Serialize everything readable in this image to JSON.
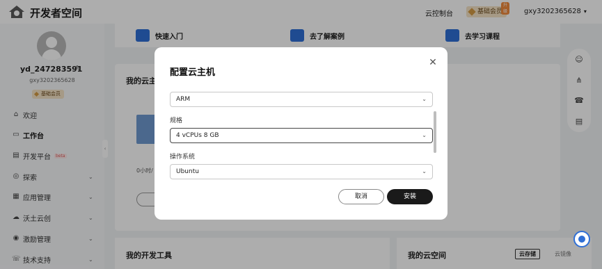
{
  "header": {
    "app_title": "开发者空间",
    "console_label": "云控制台",
    "member_label": "基础会员",
    "member_tag": "升级",
    "username": "gxy3202365628"
  },
  "sidebar": {
    "display_name": "yd_247283591",
    "user_id": "gxy3202365628",
    "member_label": "基础会员",
    "items": [
      {
        "label": "欢迎",
        "icon": "home-icon"
      },
      {
        "label": "工作台",
        "icon": "monitor-icon"
      },
      {
        "label": "开发平台",
        "icon": "code-icon",
        "badge": "beta"
      },
      {
        "label": "探索",
        "icon": "compass-icon"
      },
      {
        "label": "应用管理",
        "icon": "grid-icon"
      },
      {
        "label": "沃土云创",
        "icon": "cloud-icon"
      },
      {
        "label": "激励管理",
        "icon": "coin-icon"
      },
      {
        "label": "技术支持",
        "icon": "support-icon"
      }
    ]
  },
  "quick_links": [
    {
      "label": "快速入门"
    },
    {
      "label": "去了解案例"
    },
    {
      "label": "去学习课程"
    }
  ],
  "main": {
    "cloud_host_title": "我的云主",
    "usage_text": "0小时/",
    "dev_tools_title": "我的开发工具",
    "cloud_space_title": "我的云空间",
    "tab_storage": "云存储",
    "tab_image": "云镜像"
  },
  "modal": {
    "title": "配置云主机",
    "arch_value": "ARM",
    "spec_label": "规格",
    "spec_value": "4 vCPUs 8 GB",
    "os_label": "操作系统",
    "os_value": "Ubuntu",
    "cancel_label": "取消",
    "install_label": "安装"
  },
  "colors": {
    "accent": "#2f6fd6",
    "primary_button": "#1a1a1a",
    "member_badge": "#f5e3c6"
  }
}
